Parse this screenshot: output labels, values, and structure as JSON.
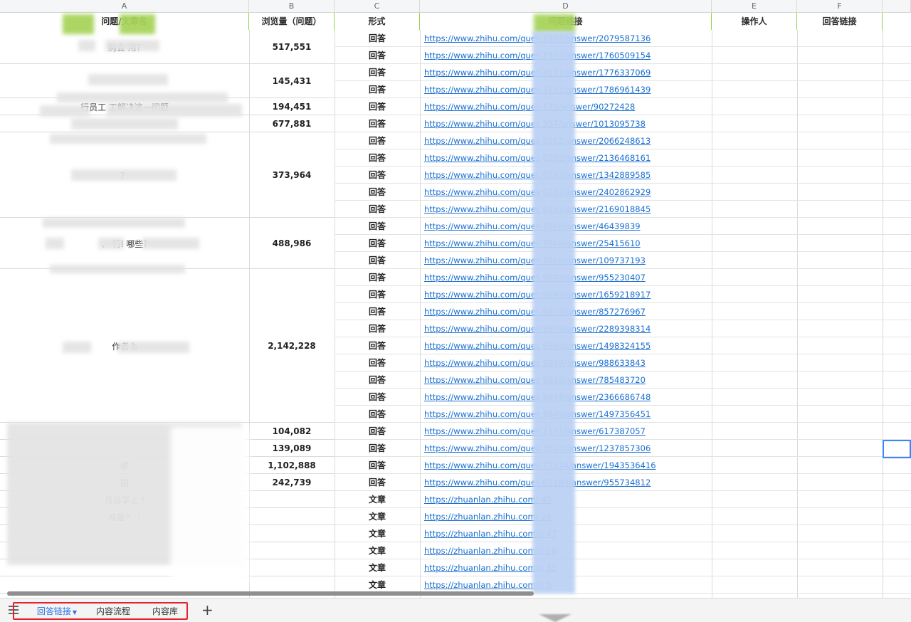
{
  "columns": [
    "A",
    "B",
    "C",
    "D",
    "E",
    "F"
  ],
  "header": {
    "question": "问题/文章名",
    "views": "浏览量（问题）",
    "form": "形式",
    "link": "问题链接",
    "operator": "操作人",
    "answer_link": "回答链接"
  },
  "groups": [
    {
      "question": "   购会         用?",
      "views": "517,551"
    },
    {
      "question": "",
      "views": "145,431"
    },
    {
      "question": "行员工                             工解决这一问题",
      "views": "194,451"
    },
    {
      "question": "",
      "views": "677,881"
    },
    {
      "question": "                ？",
      "views": "373,964"
    },
    {
      "question": "   、     行l        哪些?",
      "views": "488,986"
    },
    {
      "question": "   作者          b",
      "views": "2,142,228"
    },
    {
      "question": "",
      "views": "104,082"
    },
    {
      "question": "",
      "views": "139,089"
    },
    {
      "question": "                   都",
      "views": "1,102,888"
    },
    {
      "question": "             国",
      "views": "242,739"
    },
    {
      "question": "月自学上             !",
      "views": ""
    },
    {
      "question": "准备? （",
      "views": ""
    },
    {
      "question": "",
      "views": ""
    },
    {
      "question": "",
      "views": ""
    },
    {
      "question": "",
      "views": ""
    },
    {
      "question": "",
      "views": ""
    }
  ],
  "rows": [
    {
      "form": "回答",
      "link": "https://www.zhihu.com/ques          1502/answer/2079587136"
    },
    {
      "form": "回答",
      "link": "https://www.zhihu.com/ques          1502/answer/1760509154"
    },
    {
      "form": "回答",
      "link": "https://www.zhihu.com/ques          4131/answer/1776337069"
    },
    {
      "form": "回答",
      "link": "https://www.zhihu.com/ques          4131/answer/1786961439"
    },
    {
      "form": "回答",
      "link": "https://www.zhihu.com/ques           155/answer/90272428"
    },
    {
      "form": "回答",
      "link": "https://www.zhihu.com/ques          557/answer/1013095738"
    },
    {
      "form": "回答",
      "link": "https://www.zhihu.com/ques          0262/answer/2066248613"
    },
    {
      "form": "回答",
      "link": "https://www.zhihu.com/ques          0262/answer/2136468161"
    },
    {
      "form": "回答",
      "link": "https://www.zhihu.com/ques          0262/answer/1342889585"
    },
    {
      "form": "回答",
      "link": "https://www.zhihu.com/ques          0262/answer/2402862929"
    },
    {
      "form": "回答",
      "link": "https://www.zhihu.com/ques          0262/answer/2169018845"
    },
    {
      "form": "回答",
      "link": "https://www.zhihu.com/ques          7866/answer/46439839"
    },
    {
      "form": "回答",
      "link": "https://www.zhihu.com/ques          7866/answer/25415610"
    },
    {
      "form": "回答",
      "link": "https://www.zhihu.com/ques          7866/answer/109737193"
    },
    {
      "form": "回答",
      "link": "https://www.zhihu.com/ques          9849/answer/955230407"
    },
    {
      "form": "回答",
      "link": "https://www.zhihu.com/ques          9849/answer/1659218917"
    },
    {
      "form": "回答",
      "link": "https://www.zhihu.com/ques          9849/answer/857276967"
    },
    {
      "form": "回答",
      "link": "https://www.zhihu.com/ques          9849/answer/2289398314"
    },
    {
      "form": "回答",
      "link": "https://www.zhihu.com/ques          9849/answer/1498324155"
    },
    {
      "form": "回答",
      "link": "https://www.zhihu.com/ques          9849/answer/988633843"
    },
    {
      "form": "回答",
      "link": "https://www.zhihu.com/ques          9849/answer/785483720"
    },
    {
      "form": "回答",
      "link": "https://www.zhihu.com/ques          9849/answer/2366686748"
    },
    {
      "form": "回答",
      "link": "https://www.zhihu.com/ques          9849/answer/1497356451"
    },
    {
      "form": "回答",
      "link": "https://www.zhihu.com/ques          1171/answer/617387057"
    },
    {
      "form": "回答",
      "link": "https://www.zhihu.com/ques          3823/answer/1237857306"
    },
    {
      "form": "回答",
      "link": "https://www.zhihu.com/ques          77534/answer/1943536416"
    },
    {
      "form": "回答",
      "link": "https://www.zhihu.com/ques          02189/answer/955734812"
    },
    {
      "form": "文章",
      "link": "https://zhuanlan.zhihu.com/          45"
    },
    {
      "form": "文章",
      "link": "https://zhuanlan.zhihu.com/          24"
    },
    {
      "form": "文章",
      "link": "https://zhuanlan.zhihu.com/p          47"
    },
    {
      "form": "文章",
      "link": "https://zhuanlan.zhihu.com/p          16"
    },
    {
      "form": "文章",
      "link": "https://zhuanlan.zhihu.com/p          31"
    },
    {
      "form": "文章",
      "link": "https://zhuanlan.zhihu.com/p          5"
    }
  ],
  "tabs": [
    {
      "label": "回答链接",
      "active": true
    },
    {
      "label": "内容流程",
      "active": false
    },
    {
      "label": "内容库",
      "active": false
    }
  ],
  "tab_bar": {
    "menu_icon": "list-icon",
    "add_icon": "plus-icon"
  },
  "colors": {
    "header_bg": "#84c225",
    "link": "#1a6fd1",
    "active_tab": "#2b74e0",
    "tab_highlight": "#e5212b"
  }
}
